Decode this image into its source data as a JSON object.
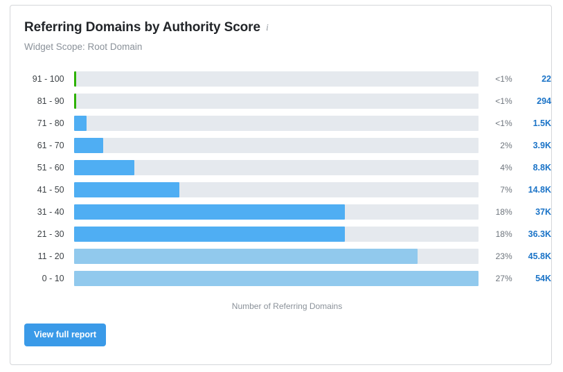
{
  "widget": {
    "title": "Referring Domains by Authority Score",
    "info_icon": "info-icon",
    "subtitle": "Widget Scope: Root Domain",
    "axis_label": "Number of Referring Domains",
    "button_label": "View full report"
  },
  "colors": {
    "bar_green": "#2db200",
    "bar_blue": "#4faef3",
    "bar_blue_light": "#91c9ed",
    "track": "#e5e9ee",
    "value_link": "#1a73c7",
    "button": "#3a9ae8"
  },
  "chart_data": {
    "type": "bar",
    "orientation": "horizontal",
    "title": "Referring Domains by Authority Score",
    "subtitle": "Widget Scope: Root Domain",
    "xlabel": "Number of Referring Domains",
    "ylabel": "Authority Score",
    "grid": false,
    "legend": false,
    "categories": [
      "91 - 100",
      "81 - 90",
      "71 - 80",
      "61 - 70",
      "51 - 60",
      "41 - 50",
      "31 - 40",
      "21 - 30",
      "11 - 20",
      "0 - 10"
    ],
    "values": [
      22,
      294,
      1500,
      3900,
      8800,
      14800,
      37000,
      36300,
      45800,
      54000
    ],
    "value_labels": [
      "22",
      "294",
      "1.5K",
      "3.9K",
      "8.8K",
      "14.8K",
      "37K",
      "36.3K",
      "45.8K",
      "54K"
    ],
    "percent_labels": [
      "<1%",
      "<1%",
      "<1%",
      "2%",
      "4%",
      "7%",
      "18%",
      "18%",
      "23%",
      "27%"
    ],
    "bar_fill_percent": [
      0.5,
      0.6,
      3.2,
      7.2,
      15.0,
      26.0,
      67.0,
      67.0,
      85.0,
      100.0
    ],
    "bar_colors": [
      "#2db200",
      "#2db200",
      "#4faef3",
      "#4faef3",
      "#4faef3",
      "#4faef3",
      "#4faef3",
      "#4faef3",
      "#91c9ed",
      "#91c9ed"
    ],
    "rows": [
      {
        "label": "91 - 100",
        "percent": "<1%",
        "value": "22",
        "fill": 0.5,
        "color": "#2db200"
      },
      {
        "label": "81 - 90",
        "percent": "<1%",
        "value": "294",
        "fill": 0.6,
        "color": "#2db200"
      },
      {
        "label": "71 - 80",
        "percent": "<1%",
        "value": "1.5K",
        "fill": 3.2,
        "color": "#4faef3"
      },
      {
        "label": "61 - 70",
        "percent": "2%",
        "value": "3.9K",
        "fill": 7.2,
        "color": "#4faef3"
      },
      {
        "label": "51 - 60",
        "percent": "4%",
        "value": "8.8K",
        "fill": 15.0,
        "color": "#4faef3"
      },
      {
        "label": "41 - 50",
        "percent": "7%",
        "value": "14.8K",
        "fill": 26.0,
        "color": "#4faef3"
      },
      {
        "label": "31 - 40",
        "percent": "18%",
        "value": "37K",
        "fill": 67.0,
        "color": "#4faef3"
      },
      {
        "label": "21 - 30",
        "percent": "18%",
        "value": "36.3K",
        "fill": 67.0,
        "color": "#4faef3"
      },
      {
        "label": "11 - 20",
        "percent": "23%",
        "value": "45.8K",
        "fill": 85.0,
        "color": "#91c9ed"
      },
      {
        "label": "0 - 10",
        "percent": "27%",
        "value": "54K",
        "fill": 100.0,
        "color": "#91c9ed"
      }
    ]
  }
}
